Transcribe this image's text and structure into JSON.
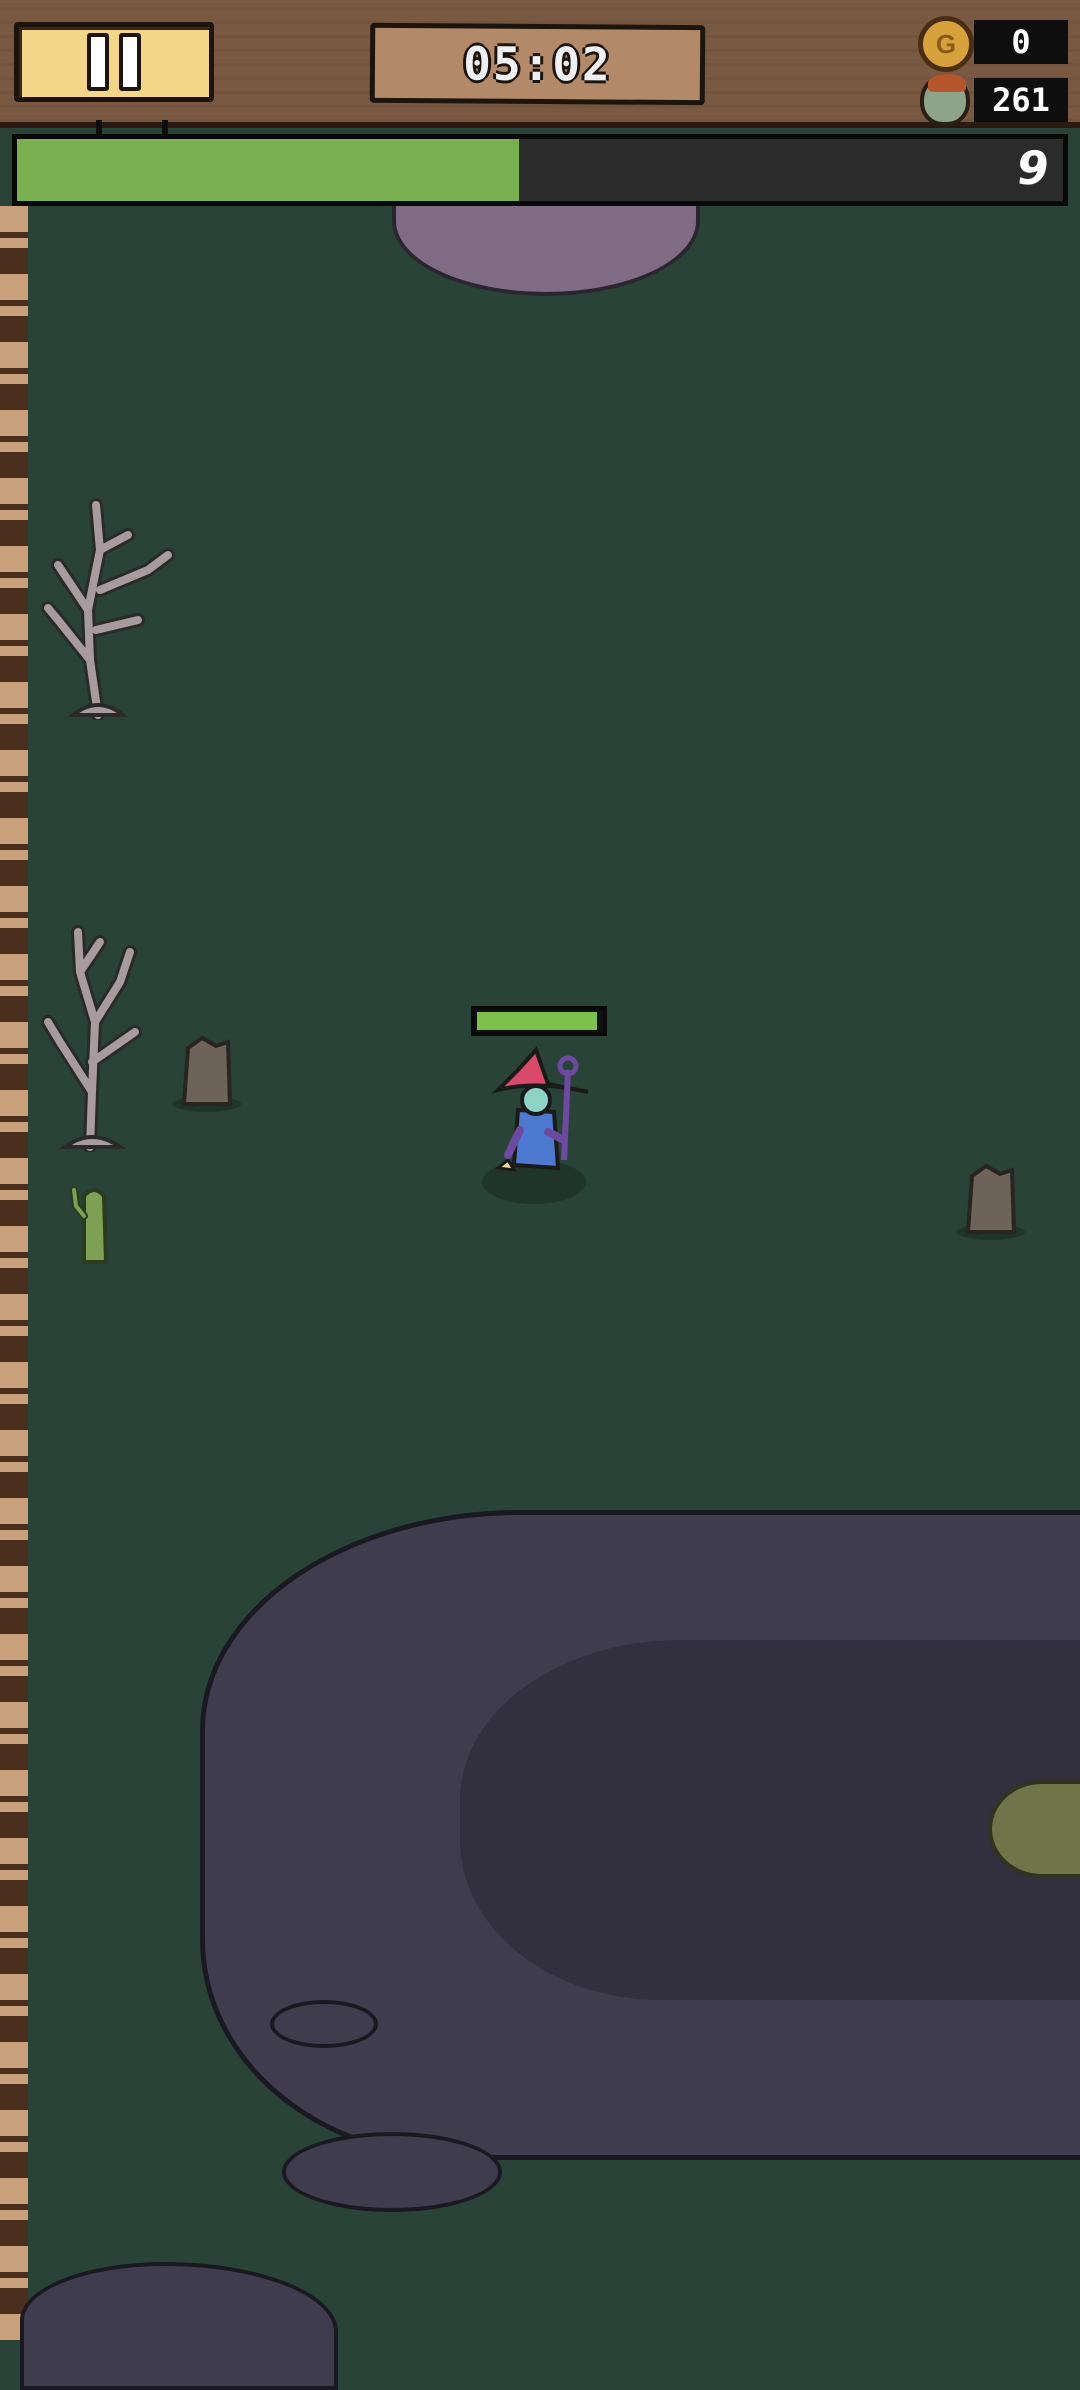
{
  "hud": {
    "timer": "05:02",
    "coins": "0",
    "kills": "261"
  },
  "xp": {
    "level": "9",
    "progress": 0.48,
    "fill_color": "#7ab04f"
  },
  "player": {
    "health": 0.97,
    "hp_color": "#7dc04c"
  },
  "icons": {
    "pause": "pause-icon",
    "coin": "coin-icon",
    "kills": "zombie-head-icon"
  },
  "colors": {
    "ground": "#294339",
    "swamp": "#3f3d4d",
    "hud_wood": "#7a5942",
    "pause_button": "#f3d68a"
  }
}
